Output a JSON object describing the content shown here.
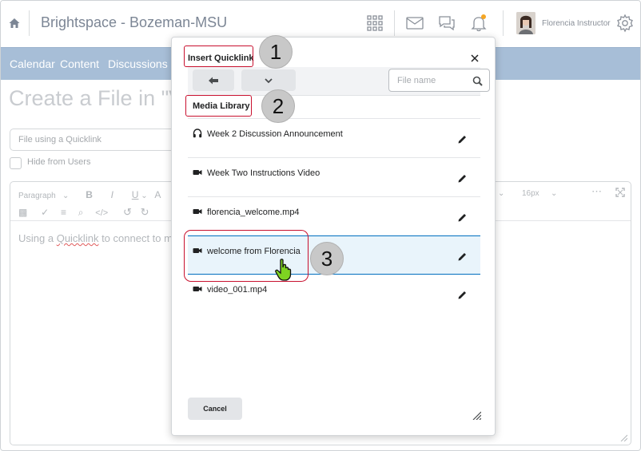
{
  "header": {
    "org_title": "Brightspace - Bozeman-MSU",
    "user_name": "Florencia Instructor",
    "notification_dot_color": "#f5a623"
  },
  "nav": {
    "items": [
      {
        "label": "Calendar"
      },
      {
        "label": "Content"
      },
      {
        "label": "Discussions"
      }
    ]
  },
  "background_page": {
    "title": "Create a File in \"V",
    "quicklink_placeholder": "File using a Quicklink",
    "hide_from_users_label": "Hide from Users",
    "editor": {
      "format_dropdown": "Paragraph",
      "font_size": "16px",
      "body_text_before": "Using a ",
      "body_text_misspelled": "Quicklink",
      "body_text_after": " to connect to m"
    }
  },
  "dialog": {
    "title": "Insert Quicklink",
    "search_placeholder": "File name",
    "section_title": "Media Library",
    "items": [
      {
        "label": "Week 2 Discussion Announcement",
        "icon": "headphones-icon"
      },
      {
        "label": "Week Two Instructions Video",
        "icon": "video-camera-icon"
      },
      {
        "label": "florencia_welcome.mp4",
        "icon": "video-camera-icon"
      },
      {
        "label": "welcome from Florencia",
        "icon": "video-camera-icon",
        "selected": true
      },
      {
        "label": "video_001.mp4",
        "icon": "video-camera-icon"
      }
    ],
    "cancel_label": "Cancel"
  },
  "callouts": {
    "one": "1",
    "two": "2",
    "three": "3",
    "highlight_color": "#c8102e"
  }
}
